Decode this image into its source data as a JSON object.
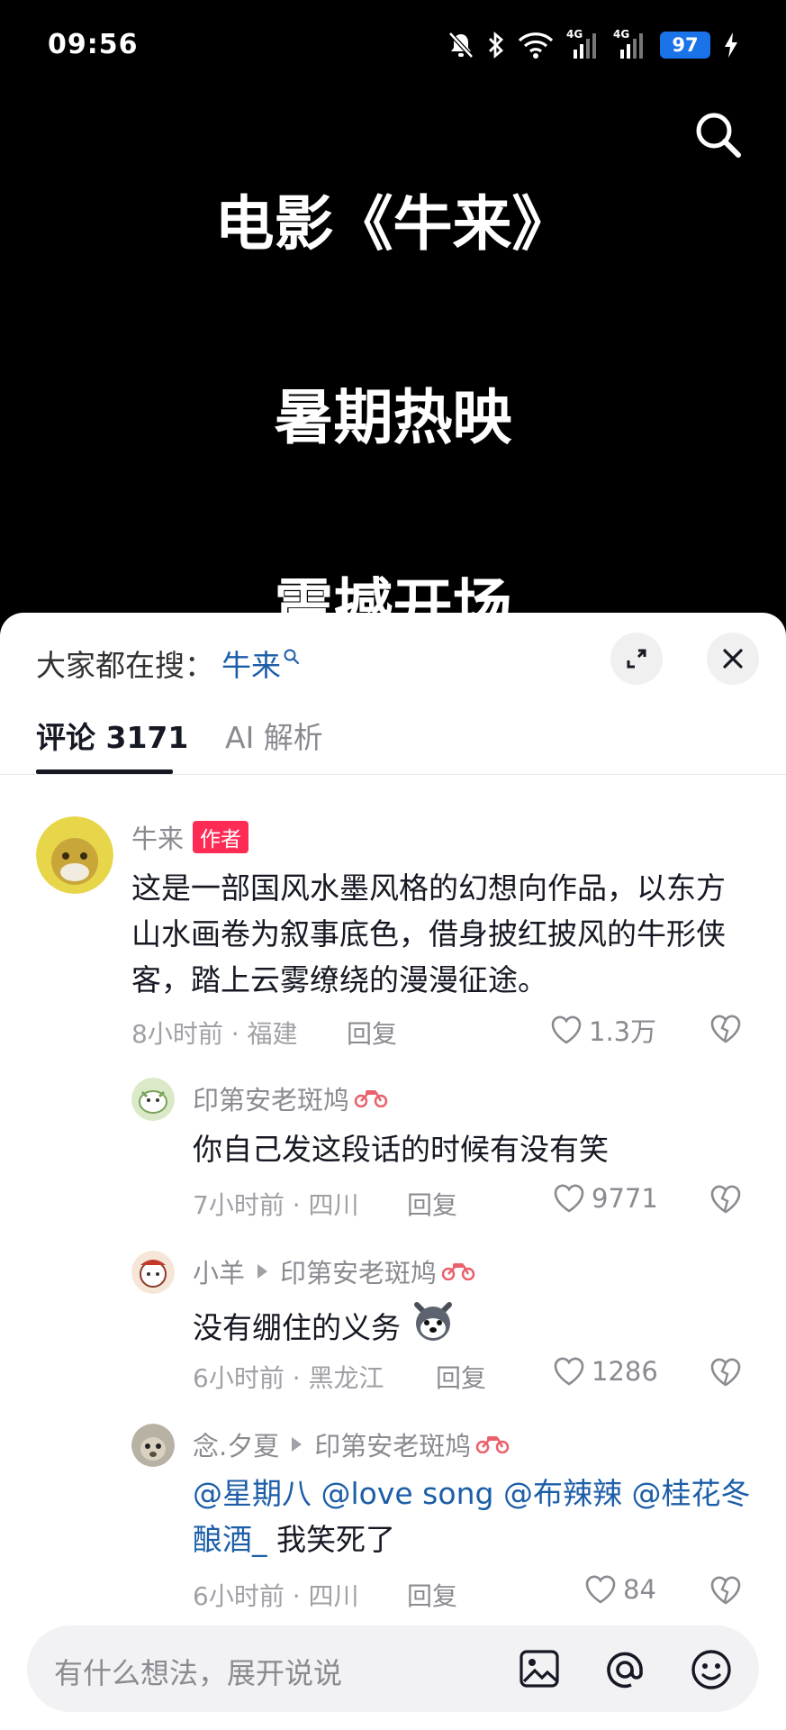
{
  "status_bar": {
    "time": "09:56",
    "network_label_1": "4G",
    "network_label_2": "4G",
    "battery": "97",
    "icons": [
      "mute-icon",
      "bluetooth-icon",
      "wifi-icon",
      "signal-icon",
      "signal-icon",
      "battery-icon",
      "charging-icon"
    ]
  },
  "video": {
    "lines": [
      "电影《牛来》",
      "暑期热映",
      "震撼开场"
    ]
  },
  "sheet": {
    "hot_search_label": "大家都在搜：",
    "hot_search_keyword": "牛来",
    "tabs": [
      {
        "label": "评论 3171",
        "active": true
      },
      {
        "label": "AI 解析",
        "active": false
      }
    ]
  },
  "comments": [
    {
      "user": "牛来",
      "badge": "作者",
      "text": "这是一部国风水墨风格的幻想向作品，以东方山水画卷为叙事底色，借身披红披风的牛形侠客，踏上云雾缭绕的漫漫征途。",
      "meta": "8小时前 · 福建",
      "reply": "回复",
      "likes": "1.3万"
    },
    {
      "user": "印第安老斑鸠",
      "text": "你自己发这段话的时候有没有笑",
      "meta": "7小时前 · 四川",
      "reply": "回复",
      "likes": "9771"
    },
    {
      "user": "小羊",
      "reply_to": "印第安老斑鸠",
      "text": "没有绷住的义务",
      "meta": "6小时前 · 黑龙江",
      "reply": "回复",
      "likes": "1286"
    },
    {
      "user": "念.夕夏",
      "reply_to": "印第安老斑鸠",
      "mentions": [
        "@星期八",
        "@love song",
        "@布辣辣",
        "@桂花冬酿酒_"
      ],
      "text_after": "我笑死了",
      "meta": "6小时前 · 四川",
      "reply": "回复",
      "likes": "84"
    }
  ],
  "input_bar": {
    "placeholder": "有什么想法，展开说说",
    "icons": [
      "image-icon",
      "at-icon",
      "emoji-icon"
    ]
  },
  "colors": {
    "accent_red": "#fe2c55",
    "link_blue": "#1c5ea8",
    "battery_blue": "#1a73e8"
  }
}
